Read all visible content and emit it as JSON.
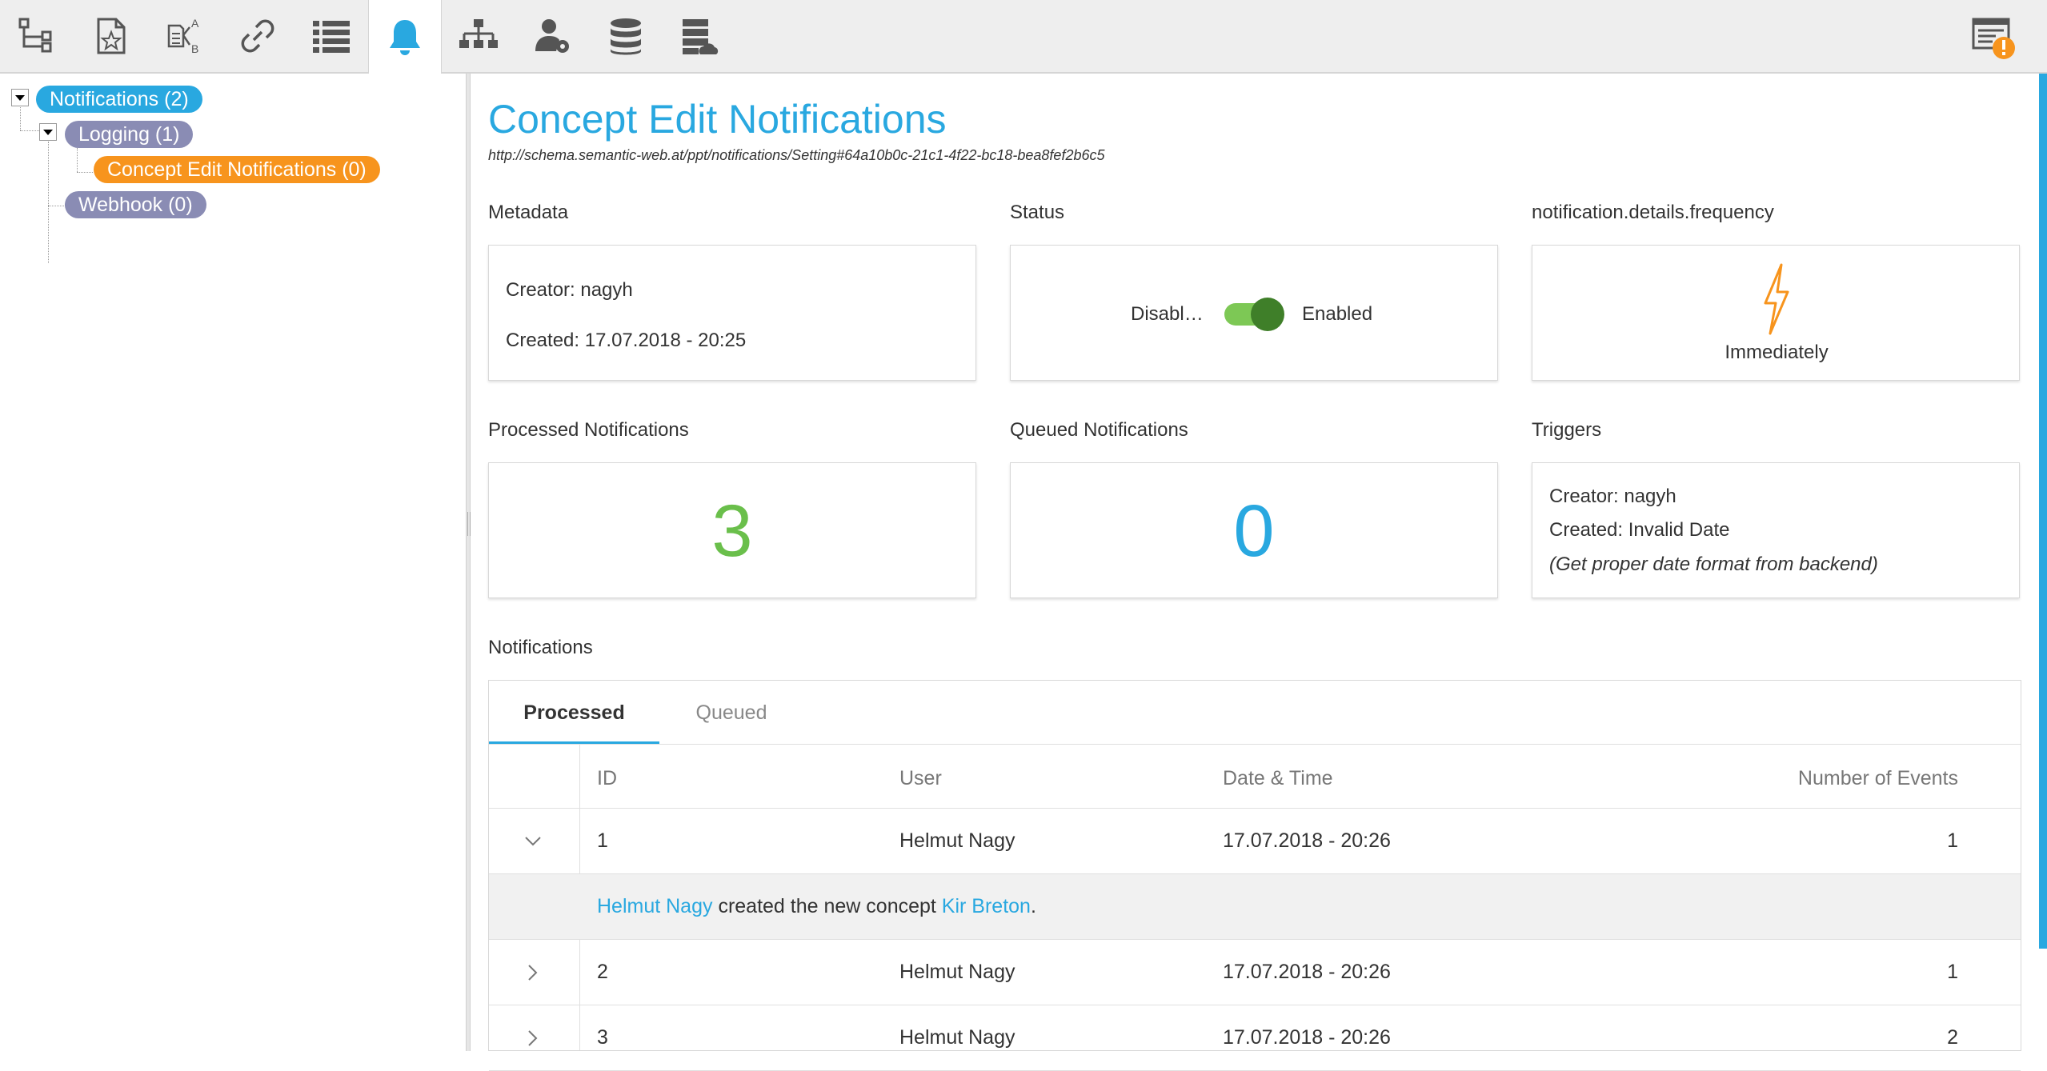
{
  "toolbar": {
    "tools": [
      {
        "icon": "tree-structure-icon"
      },
      {
        "icon": "document-star-icon"
      },
      {
        "icon": "document-ab-icon"
      },
      {
        "icon": "link-icon"
      },
      {
        "icon": "list-icon"
      },
      {
        "icon": "bell-icon",
        "active": true
      },
      {
        "icon": "hierarchy-icon"
      },
      {
        "icon": "user-settings-icon"
      },
      {
        "icon": "database-icon"
      },
      {
        "icon": "server-cloud-icon"
      }
    ],
    "alert_icon": "warning-panel-icon"
  },
  "tree": {
    "root": "Notifications (2)",
    "logging": "Logging (1)",
    "concept_edit": "Concept Edit Notifications (0)",
    "webhook": "Webhook (0)"
  },
  "main": {
    "title": "Concept Edit Notifications",
    "uri": "http://schema.semantic-web.at/ppt/notifications/Setting#64a10b0c-21c1-4f22-bc18-bea8fef2b6c5",
    "metadata": {
      "label": "Metadata",
      "creator": "Creator: nagyh",
      "created": "Created: 17.07.2018 - 20:25"
    },
    "status": {
      "label": "Status",
      "off_label": "Disabl…",
      "on_label": "Enabled",
      "enabled": true
    },
    "frequency": {
      "label": "notification.details.frequency",
      "icon": "lightning-icon",
      "value": "Immediately"
    },
    "processed": {
      "label": "Processed Notifications",
      "count": "3"
    },
    "queued": {
      "label": "Queued Notifications",
      "count": "0"
    },
    "triggers": {
      "label": "Triggers",
      "creator": "Creator: nagyh",
      "created": "Created: Invalid Date",
      "note": "(Get proper date format from backend)"
    },
    "notifications": {
      "label": "Notifications",
      "tabs": [
        "Processed",
        "Queued"
      ],
      "columns": [
        "ID",
        "User",
        "Date & Time",
        "Number of Events"
      ],
      "rows": [
        {
          "id": "1",
          "user": "Helmut Nagy",
          "datetime": "17.07.2018 - 20:26",
          "events": "1",
          "expanded": true
        },
        {
          "id": "2",
          "user": "Helmut Nagy",
          "datetime": "17.07.2018 - 20:26",
          "events": "1",
          "expanded": false
        },
        {
          "id": "3",
          "user": "Helmut Nagy",
          "datetime": "17.07.2018 - 20:26",
          "events": "2",
          "expanded": false
        }
      ],
      "detail": {
        "actor": "Helmut Nagy",
        "text": " created the new concept ",
        "concept": "Kir Breton",
        "end": "."
      }
    }
  },
  "colors": {
    "accent": "#29a8e0",
    "processed_green": "#6abf4b",
    "orange": "#f7941d",
    "purple": "#8a8cb4",
    "toggle_on": "#7dc855"
  }
}
